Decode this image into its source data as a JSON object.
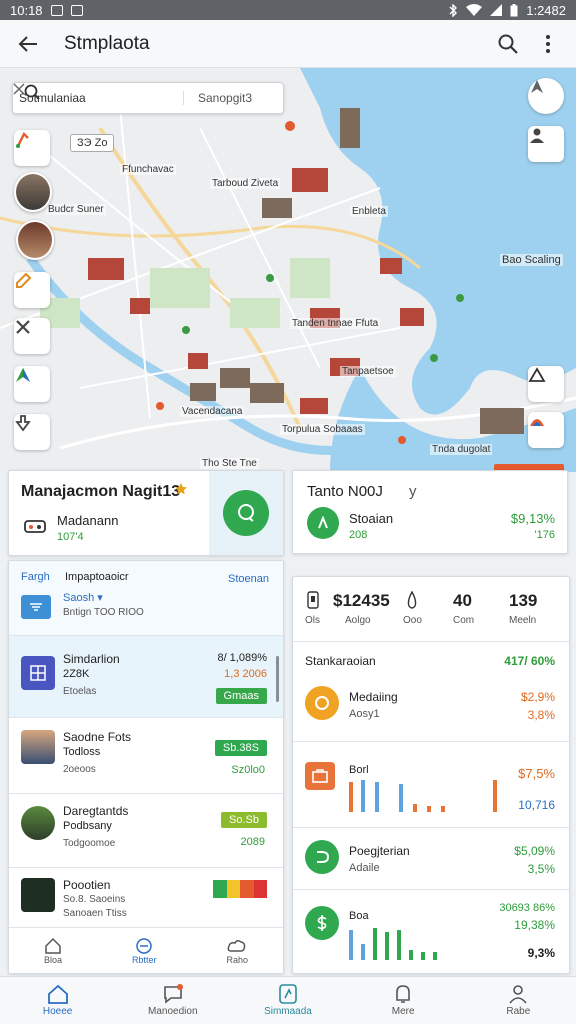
{
  "status_bar": {
    "time": "10:18",
    "right_text": "1:2482"
  },
  "app_bar": {
    "title": "Stmplaota"
  },
  "map": {
    "search_query": "Sotmulaniaa",
    "search_secondary": "Sanopgit3",
    "zoom_chip": "ЗЭ Zo",
    "labels": [
      "Budcr Suner",
      "Ffunchavac",
      "Tarboud Ziveta",
      "Enbleta",
      "Bao Scaling",
      "Tanden tnnae Ffuta",
      "Tanpaetsoe",
      "Vacendacana",
      "Torpulua Sobaaas",
      "Tnda dugolat",
      "Tho Ste Tne"
    ]
  },
  "nav_card": {
    "title": "Manajacmon Nagit13",
    "subtitle": "Madanann",
    "value": "107'4"
  },
  "tento_card": {
    "title": "Tanto N00J",
    "suffix": "y",
    "label": "Stoaian",
    "sub": "208",
    "value": "$9,13%",
    "sub_value": "'176"
  },
  "list_card": {
    "header_left": "Fargh",
    "header_mid": "Impaptoaoicr",
    "header_right": "Stoenan",
    "sub_label": "Saosh ▾",
    "sub_text": "Bntign TOO RIOO",
    "rows": [
      {
        "title": "Simdarlion",
        "sub": "2Z8K",
        "sub2": "Etoelas",
        "value": "8/ 1,089%",
        "value2": "1,3 2006",
        "pill": "Gmaas"
      },
      {
        "title": "Saodne Fots",
        "sub": "Todloss",
        "sub2": "2oeoos",
        "value": "Sb.38S",
        "value2": "Sz0lo0",
        "pill": ""
      },
      {
        "title": "Daregtantds",
        "sub": "Podbsany",
        "sub2": "Todgoomoe",
        "value": "So.Sb",
        "value2": "2089",
        "pill": ""
      },
      {
        "title": "Poootien",
        "sub": "So.8. Saoeins",
        "sub2": "Sanoaen Ttiss",
        "value": "",
        "value2": "",
        "pill": ""
      }
    ],
    "mini_tabs": [
      "Bloa",
      "Rbtter",
      "Raho"
    ]
  },
  "stats_card": {
    "stats": [
      {
        "value": "$12435",
        "label": "Ols"
      },
      {
        "value": "",
        "label": "Aolgo"
      },
      {
        "value": "",
        "label": "Ooo"
      },
      {
        "value": "40",
        "label": "Com"
      },
      {
        "value": "139",
        "label": "Meeln"
      }
    ],
    "section_label": "Stankaraoian",
    "section_value": "417/ 60%",
    "rows": [
      {
        "title": "Medaiing",
        "sub": "Aosy1",
        "value": "$2,9%",
        "value2": "3,8%"
      },
      {
        "title": "Borl",
        "sub": "",
        "value": "$7,5%",
        "value2": "10,716"
      },
      {
        "title": "Poegjterian",
        "sub": "Adaile",
        "value": "$5,09%",
        "value2": "3,5%"
      },
      {
        "title": "Boa",
        "sub": "",
        "value": "30693 86%",
        "value2": "19,38%",
        "value3": "9,3%"
      }
    ]
  },
  "tab_bar": {
    "tabs": [
      "Hoeee",
      "Manoedion",
      "Simmaada",
      "Mere",
      "Rabe"
    ]
  },
  "colors": {
    "accent_green": "#2e9d3a",
    "accent_blue": "#2a6ec2",
    "water": "#9ed0ef",
    "map_bg": "#e9ecef"
  }
}
